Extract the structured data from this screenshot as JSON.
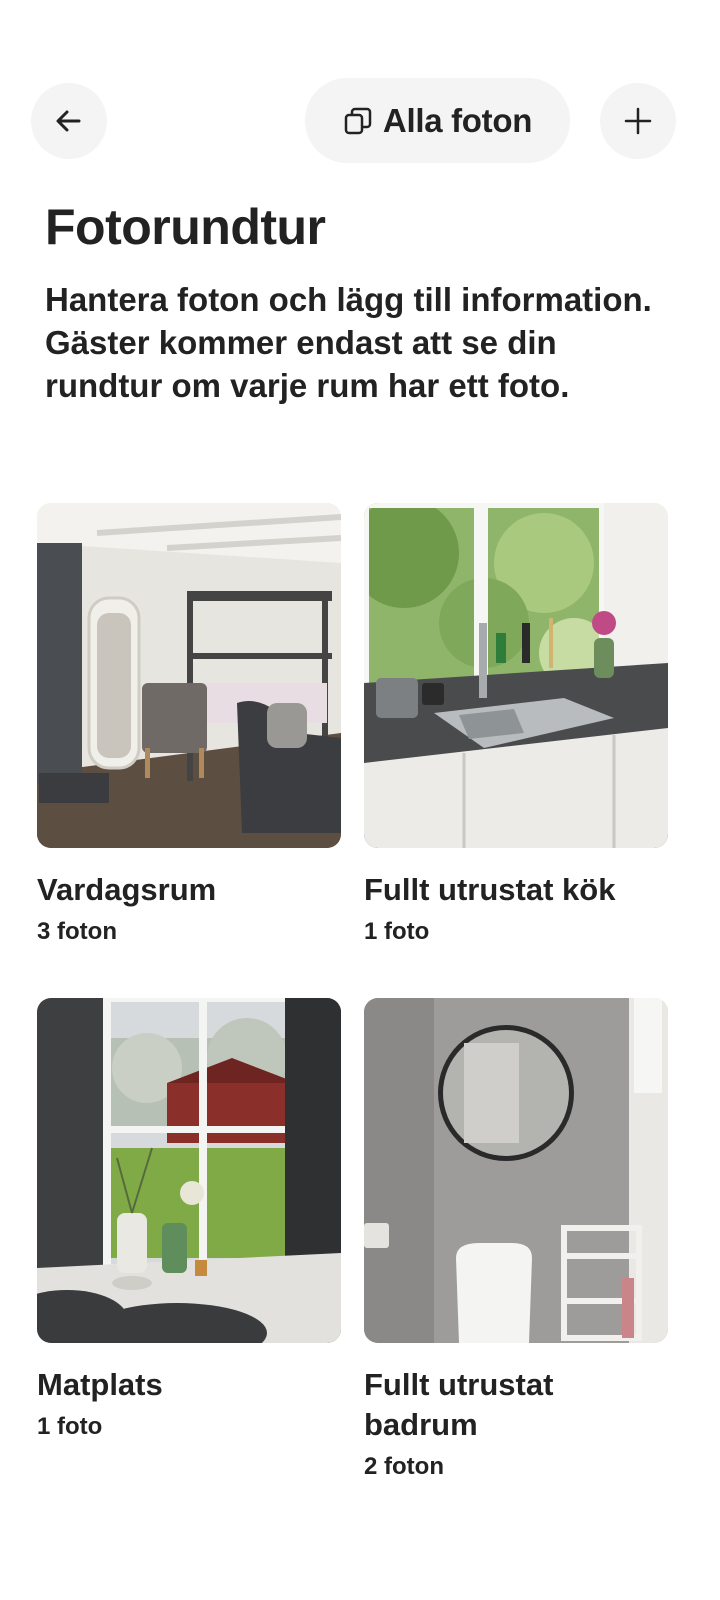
{
  "header": {
    "back_icon": "arrow-left-icon",
    "all_photos_icon": "copy-stack-icon",
    "all_photos_label": "Alla foton",
    "add_icon": "plus-icon"
  },
  "main": {
    "title": "Fotorundtur",
    "description": "Hantera foton och lägg till information. Gäster kommer endast att se din rundtur om varje rum har ett foto."
  },
  "rooms": [
    {
      "title": "Vardagsrum",
      "count": "3 foton",
      "photo": "living-room-photo"
    },
    {
      "title": "Fullt utrustat kök",
      "count": "1 foto",
      "photo": "kitchen-photo"
    },
    {
      "title": "Matplats",
      "count": "1 foto",
      "photo": "dining-area-photo"
    },
    {
      "title": "Fullt utrustat badrum",
      "count": "2 foton",
      "photo": "bathroom-photo"
    }
  ]
}
